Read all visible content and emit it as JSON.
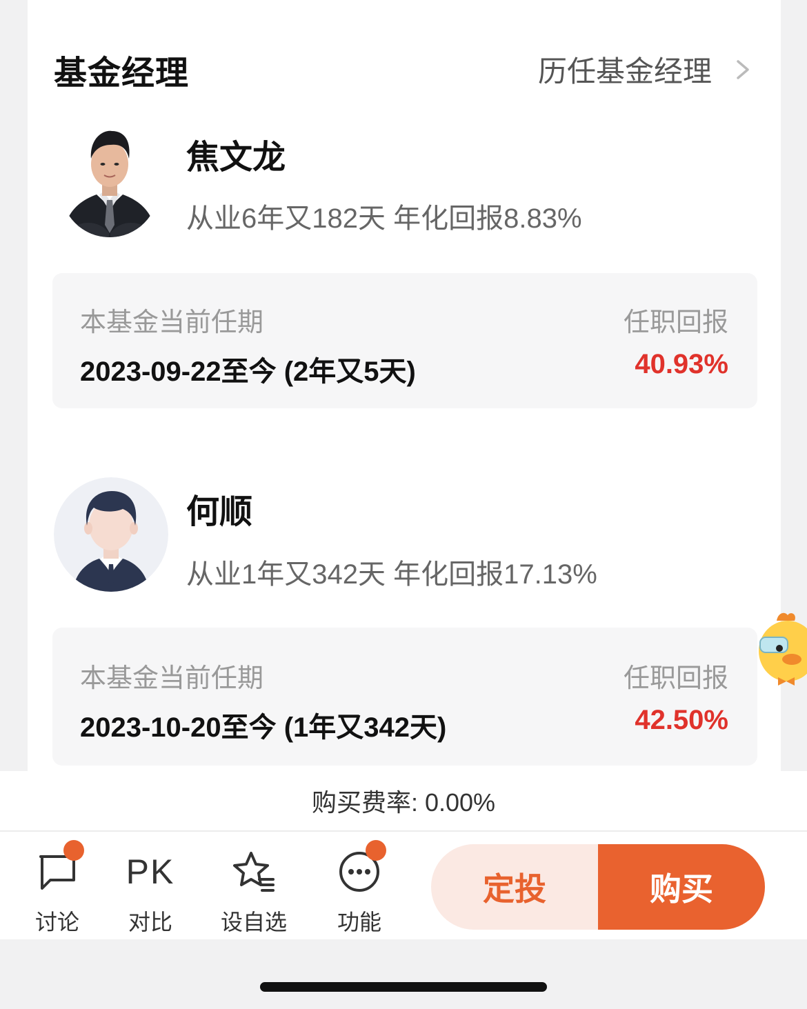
{
  "section": {
    "title": "基金经理",
    "history_link": "历任基金经理"
  },
  "managers": [
    {
      "name": "焦文龙",
      "stats": "从业6年又182天 年化回报8.83%",
      "term_label": "本基金当前任期",
      "return_label": "任职回报",
      "term_date": "2023-09-22至今 (2年又5天)",
      "term_return": "40.93%"
    },
    {
      "name": "何顺",
      "stats": "从业1年又342天 年化回报17.13%",
      "term_label": "本基金当前任期",
      "return_label": "任职回报",
      "term_date": "2023-10-20至今 (1年又342天)",
      "term_return": "42.50%"
    }
  ],
  "fee": {
    "text": "购买费率: 0.00%"
  },
  "toolbar": {
    "discuss": "讨论",
    "pk_icon_text": "PK",
    "compare": "对比",
    "watchlist": "设自选",
    "functions": "功能",
    "sip_button": "定投",
    "buy_button": "购买"
  },
  "colors": {
    "accent": "#e9622f",
    "return_red": "#e0322b",
    "sip_bg": "#fbe9e3"
  },
  "icons": [
    "chevron-right-icon",
    "chat-bubble-icon",
    "star-list-icon",
    "more-dots-icon",
    "mascot-chick-icon"
  ]
}
